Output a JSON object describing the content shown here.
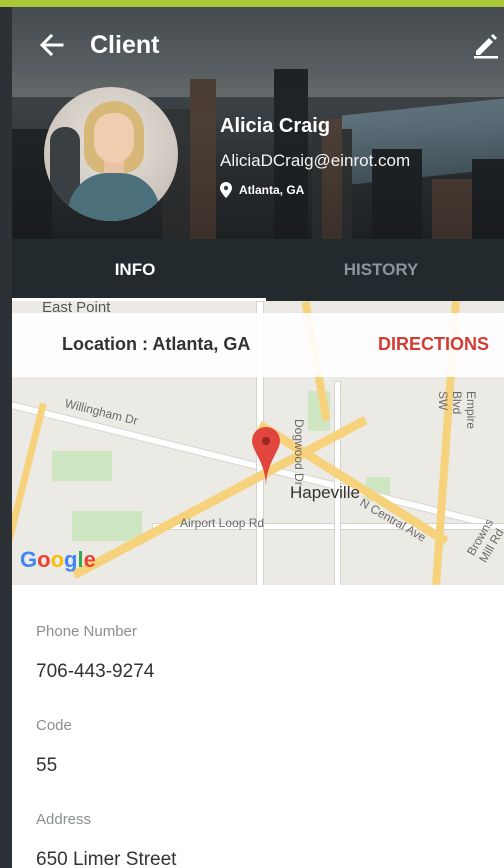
{
  "header": {
    "title": "Client",
    "back_icon": "arrow-left-icon",
    "edit_icon": "pencil-icon"
  },
  "profile": {
    "name": "Alicia Craig",
    "email": "AliciaDCraig@einrot.com",
    "location": "Atlanta, GA",
    "location_icon": "map-pin-icon"
  },
  "tabs": [
    {
      "label": "INFO",
      "active": true
    },
    {
      "label": "HISTORY",
      "active": false
    }
  ],
  "map": {
    "location_label": "Location : Atlanta, GA",
    "directions_label": "DIRECTIONS",
    "place_labels": [
      "East Point",
      "Willingham Dr",
      "Dogwood Dr",
      "Empire Blvd SW",
      "Hapeville",
      "Airport Loop Rd",
      "N Central Ave",
      "Browns Mill Rd"
    ],
    "brand": "Google"
  },
  "details": {
    "fields": [
      {
        "label": "Phone Number",
        "value": "706-443-9274"
      },
      {
        "label": "Code",
        "value": "55"
      },
      {
        "label": "Address",
        "value": "650 Limer Street"
      }
    ]
  },
  "colors": {
    "accent_bar": "#a8c83a",
    "tab_bg": "#232a2e",
    "directions": "#d23c35"
  }
}
